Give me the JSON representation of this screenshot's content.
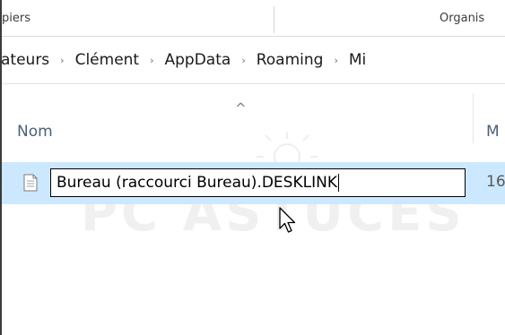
{
  "ribbon": {
    "group_clipboard": "piers",
    "group_organize": "Organis"
  },
  "address": {
    "crumbs": [
      "ateurs",
      "Clément",
      "AppData",
      "Roaming",
      "Mi"
    ],
    "separator": "›"
  },
  "columns": {
    "name": "Nom",
    "modified": "M",
    "sort_indicator": "^"
  },
  "file": {
    "rename_value": "Bureau (raccourci Bureau).DESKLINK",
    "date_partial": "16",
    "icon": "document-icon"
  },
  "colors": {
    "selection": "#cce8ff",
    "header_text": "#4c607a"
  }
}
